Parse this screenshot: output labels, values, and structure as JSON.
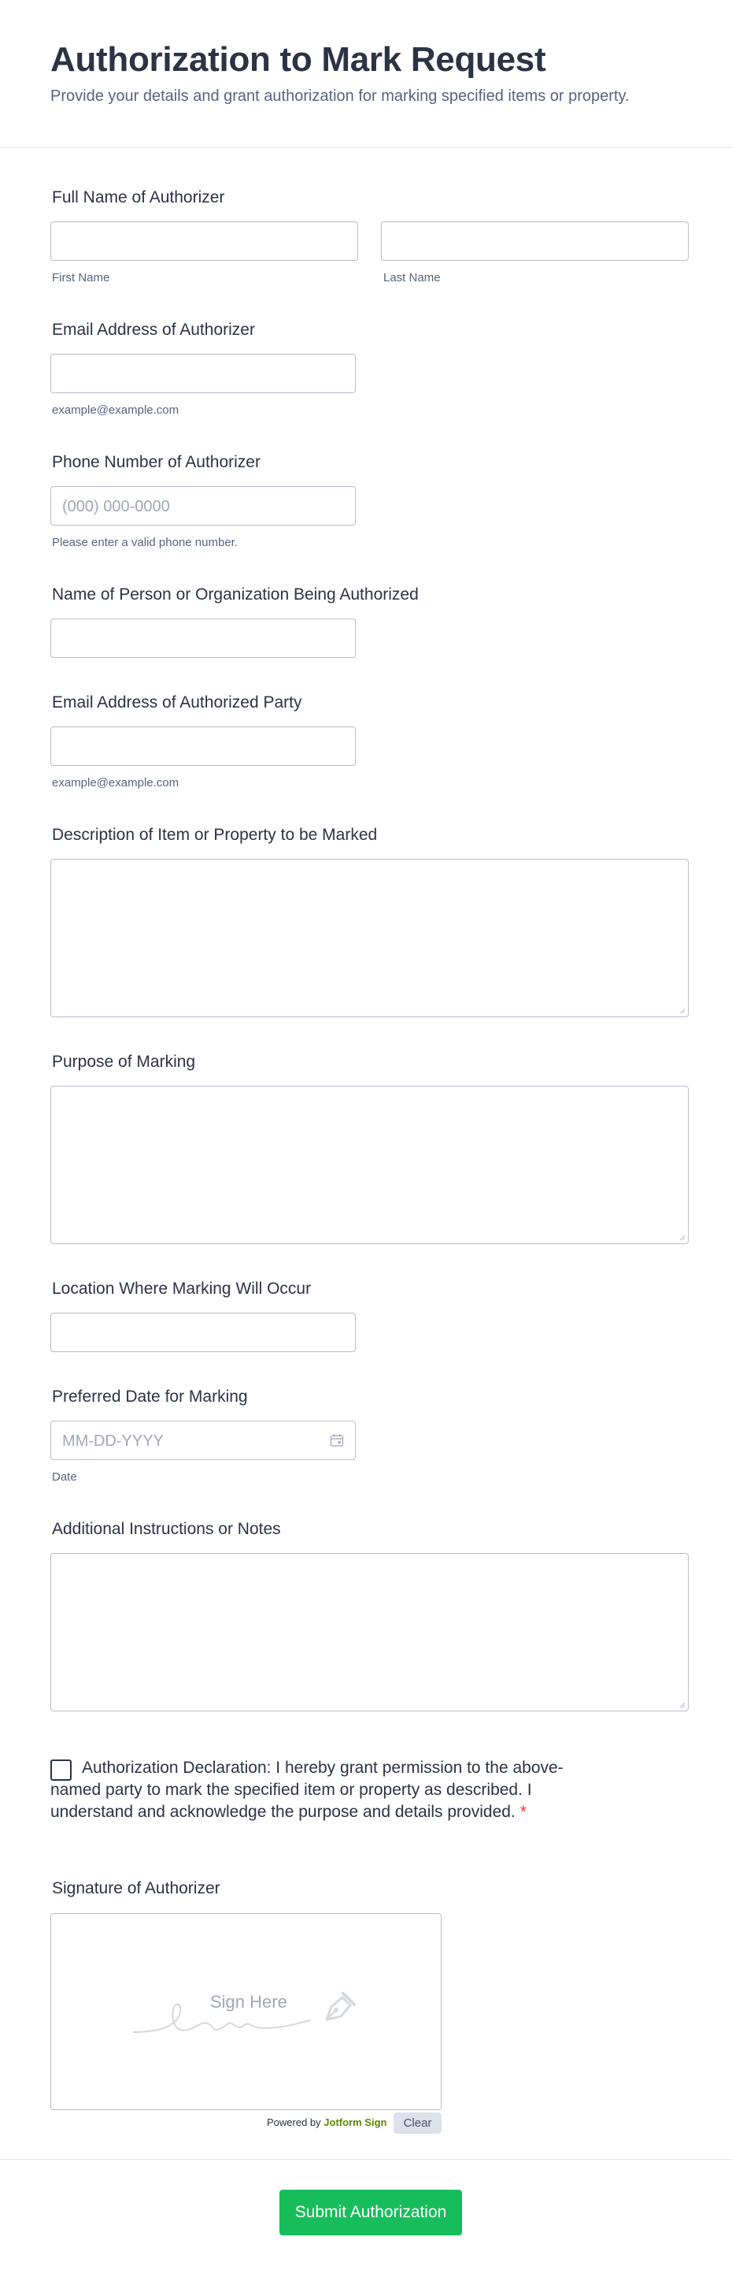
{
  "form": {
    "title": "Authorization to Mark Request",
    "subtitle": "Provide your details and grant authorization for marking specified items or property."
  },
  "fields": {
    "full_name": {
      "label": "Full Name of Authorizer",
      "first_sublabel": "First Name",
      "last_sublabel": "Last Name",
      "first_value": "",
      "last_value": ""
    },
    "authorizer_email": {
      "label": "Email Address of Authorizer",
      "sublabel": "example@example.com",
      "value": ""
    },
    "phone": {
      "label": "Phone Number of Authorizer",
      "placeholder": "(000) 000-0000",
      "sublabel": "Please enter a valid phone number.",
      "value": ""
    },
    "authorized_name": {
      "label": "Name of Person or Organization Being Authorized",
      "value": ""
    },
    "authorized_email": {
      "label": "Email Address of Authorized Party",
      "sublabel": "example@example.com",
      "value": ""
    },
    "description": {
      "label": "Description of Item or Property to be Marked",
      "value": ""
    },
    "purpose": {
      "label": "Purpose of Marking",
      "value": ""
    },
    "location": {
      "label": "Location Where Marking Will Occur",
      "value": ""
    },
    "date": {
      "label": "Preferred Date for Marking",
      "placeholder": "MM-DD-YYYY",
      "sublabel": "Date",
      "icon": "calendar-icon",
      "value": ""
    },
    "notes": {
      "label": "Additional Instructions or Notes",
      "value": ""
    },
    "declaration": {
      "text": "Authorization Declaration: I hereby grant permission to the above-named party to mark the specified item or property as described. I understand and acknowledge the purpose and details provided.",
      "required_mark": "*",
      "checked": false
    },
    "signature": {
      "label": "Signature of Authorizer",
      "placeholder": "Sign Here",
      "powered_by": "Powered by",
      "brand": "Jotform Sign",
      "clear_label": "Clear"
    }
  },
  "submit": {
    "label": "Submit Authorization"
  },
  "colors": {
    "accent": "#18bd5b",
    "required": "#f23a3c",
    "text": "#2c3345",
    "muted": "#57647e",
    "border": "#b8bdc9",
    "brand": "#5a8a00"
  }
}
